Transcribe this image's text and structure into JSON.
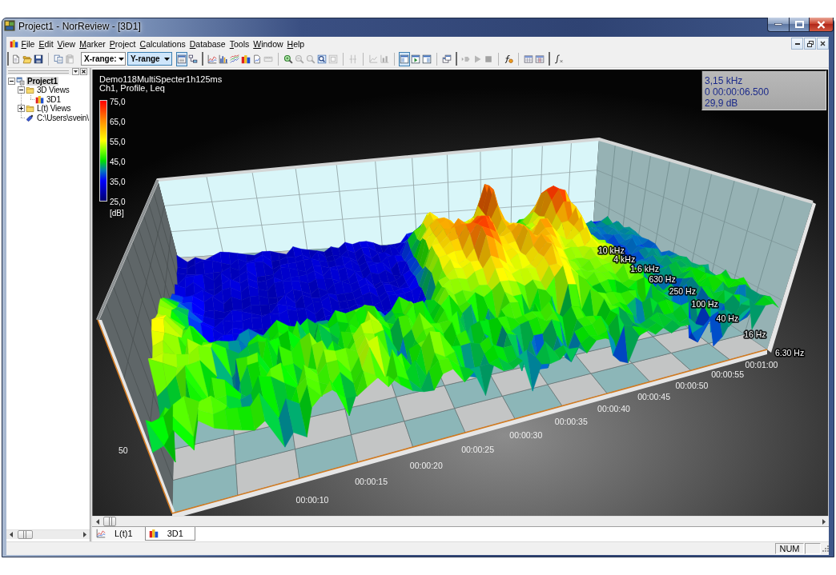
{
  "window": {
    "title": "Project1 - NorReview - [3D1]"
  },
  "menu": [
    "File",
    "Edit",
    "View",
    "Marker",
    "Project",
    "Calculations",
    "Database",
    "Tools",
    "Window",
    "Help"
  ],
  "toolbar": {
    "items": [
      {
        "kind": "grip"
      },
      {
        "kind": "button",
        "pressed": false,
        "disabled": false
      },
      {
        "kind": "button",
        "pressed": false,
        "disabled": false
      },
      {
        "kind": "button",
        "pressed": false,
        "disabled": false
      },
      {
        "kind": "separator"
      },
      {
        "kind": "button",
        "pressed": false,
        "disabled": false
      },
      {
        "kind": "button",
        "pressed": false,
        "disabled": true
      },
      {
        "kind": "dropdown",
        "label": "X-range:",
        "selected": false
      },
      {
        "kind": "dropdown",
        "label": "Y-range",
        "selected": true
      },
      {
        "kind": "button",
        "pressed": true,
        "disabled": false
      },
      {
        "kind": "button",
        "pressed": false,
        "disabled": false
      },
      {
        "kind": "grip"
      },
      {
        "kind": "button",
        "pressed": false,
        "disabled": false
      },
      {
        "kind": "button",
        "pressed": false,
        "disabled": false
      },
      {
        "kind": "button",
        "pressed": false,
        "disabled": false
      },
      {
        "kind": "button",
        "pressed": false,
        "disabled": false
      },
      {
        "kind": "button",
        "pressed": false,
        "disabled": false
      },
      {
        "kind": "button",
        "pressed": false,
        "disabled": true
      },
      {
        "kind": "separator"
      },
      {
        "kind": "button",
        "pressed": false,
        "disabled": false
      },
      {
        "kind": "button",
        "pressed": false,
        "disabled": true
      },
      {
        "kind": "button",
        "pressed": false,
        "disabled": true
      },
      {
        "kind": "button",
        "pressed": false,
        "disabled": false
      },
      {
        "kind": "button",
        "pressed": false,
        "disabled": true
      },
      {
        "kind": "separator"
      },
      {
        "kind": "button",
        "pressed": false,
        "disabled": true
      },
      {
        "kind": "separator"
      },
      {
        "kind": "button",
        "pressed": false,
        "disabled": true
      },
      {
        "kind": "button",
        "pressed": false,
        "disabled": true
      },
      {
        "kind": "separator"
      },
      {
        "kind": "button",
        "pressed": true,
        "disabled": false
      },
      {
        "kind": "button",
        "pressed": false,
        "disabled": false
      },
      {
        "kind": "button",
        "pressed": false,
        "disabled": false
      },
      {
        "kind": "separator"
      },
      {
        "kind": "button",
        "pressed": false,
        "disabled": false
      },
      {
        "kind": "grip"
      },
      {
        "kind": "button",
        "pressed": false,
        "disabled": true
      },
      {
        "kind": "button",
        "pressed": false,
        "disabled": true
      },
      {
        "kind": "button",
        "pressed": false,
        "disabled": true
      },
      {
        "kind": "separator"
      },
      {
        "kind": "button",
        "pressed": false,
        "disabled": false
      },
      {
        "kind": "separator"
      },
      {
        "kind": "button",
        "pressed": false,
        "disabled": false
      },
      {
        "kind": "button",
        "pressed": false,
        "disabled": false
      },
      {
        "kind": "grip"
      },
      {
        "kind": "button",
        "pressed": false,
        "disabled": false
      }
    ]
  },
  "project_tree": {
    "nodes": [
      {
        "label": "Project1",
        "kind": "project",
        "selected": true,
        "expanded": true,
        "children": [
          {
            "label": "3D Views",
            "kind": "folder",
            "selected": false,
            "expanded": true,
            "children": [
              {
                "label": "3D1",
                "kind": "view",
                "selected": false
              }
            ]
          },
          {
            "label": "L(t) Views",
            "kind": "folder",
            "selected": false,
            "expanded": false
          },
          {
            "label": "C:\\Users\\svein\\",
            "kind": "probe",
            "selected": false
          }
        ]
      }
    ]
  },
  "plot": {
    "title": "Demo118MultiSpecter1h125ms",
    "subtitle": "Ch1, Profile, Leq",
    "color_scale": {
      "ticks": [
        "75,0",
        "65,0",
        "55,0",
        "45,0",
        "35,0",
        "25,0"
      ],
      "unit": "[dB]"
    },
    "readout": [
      "3,15 kHz",
      "0 00:00:06.500",
      "29,9 dB"
    ],
    "frequency_labels": [
      "10 kHz",
      "4 kHz",
      "1.6 kHz",
      "630 Hz",
      "250 Hz",
      "100 Hz",
      "40 Hz",
      "16 Hz",
      "6.30 Hz"
    ],
    "time_labels": [
      "00:00:10",
      "00:00:15",
      "00:00:20",
      "00:00:25",
      "00:00:30",
      "00:00:35",
      "00:00:40",
      "00:00:45",
      "00:00:50",
      "00:00:55",
      "00:01:00"
    ],
    "level_label": "50"
  },
  "tabs": [
    {
      "label": "L(t)1",
      "kind": "line",
      "selected": false
    },
    {
      "label": "3D1",
      "kind": "view",
      "selected": true
    }
  ],
  "status_bar": {
    "indicator": "NUM"
  }
}
